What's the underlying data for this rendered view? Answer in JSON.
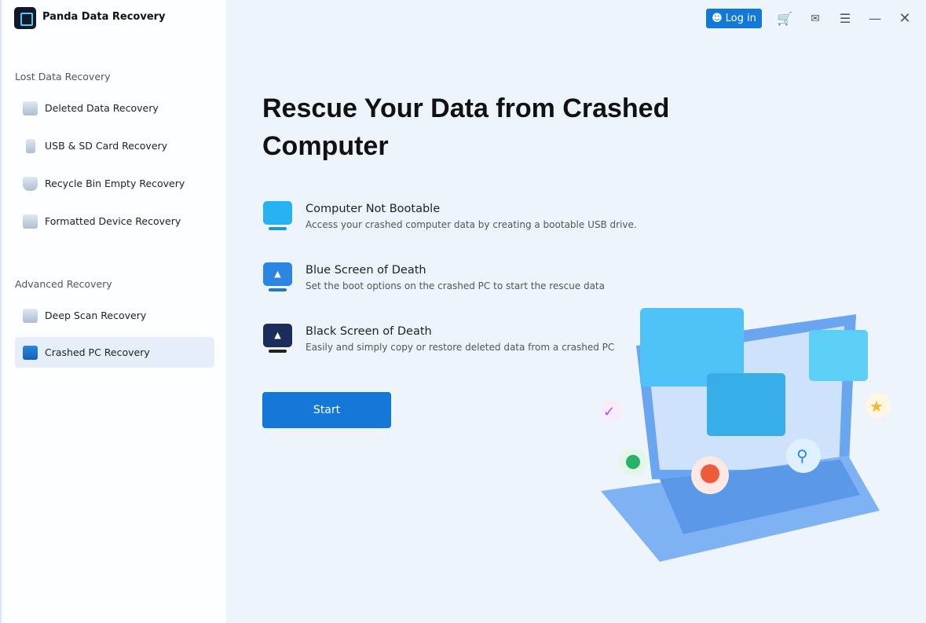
{
  "app": {
    "title": "Panda Data Recovery"
  },
  "sidebar": {
    "sections": [
      {
        "label": "Lost Data Recovery",
        "items": [
          {
            "label": "Deleted Data Recovery",
            "icon": "folder-icon"
          },
          {
            "label": "USB & SD Card Recovery",
            "icon": "usb-icon"
          },
          {
            "label": "Recycle Bin Empty Recovery",
            "icon": "recycle-bin-icon"
          },
          {
            "label": "Formatted Device Recovery",
            "icon": "drive-icon"
          }
        ]
      },
      {
        "label": "Advanced Recovery",
        "items": [
          {
            "label": "Deep Scan Recovery",
            "icon": "deep-scan-icon"
          },
          {
            "label": "Crashed PC Recovery",
            "icon": "monitor-icon",
            "active": true
          }
        ]
      }
    ]
  },
  "header": {
    "login_label": "Log in",
    "cart_color": "#f07c22"
  },
  "main": {
    "title": "Rescue Your Data from Crashed Computer",
    "options": [
      {
        "title": "Computer Not Bootable",
        "desc": "Access your crashed computer data by creating a bootable USB drive.",
        "color": "#27b2f2"
      },
      {
        "title": "Blue Screen of  Death",
        "desc": "Set the boot options on the crashed PC to start the rescue data",
        "color": "#2a86e0"
      },
      {
        "title": "Black Screen of Death",
        "desc": "Easily and simply copy or restore deleted data from a crashed PC",
        "color": "#1b2d5a"
      }
    ],
    "start_label": "Start"
  },
  "accent": "#1478d8"
}
